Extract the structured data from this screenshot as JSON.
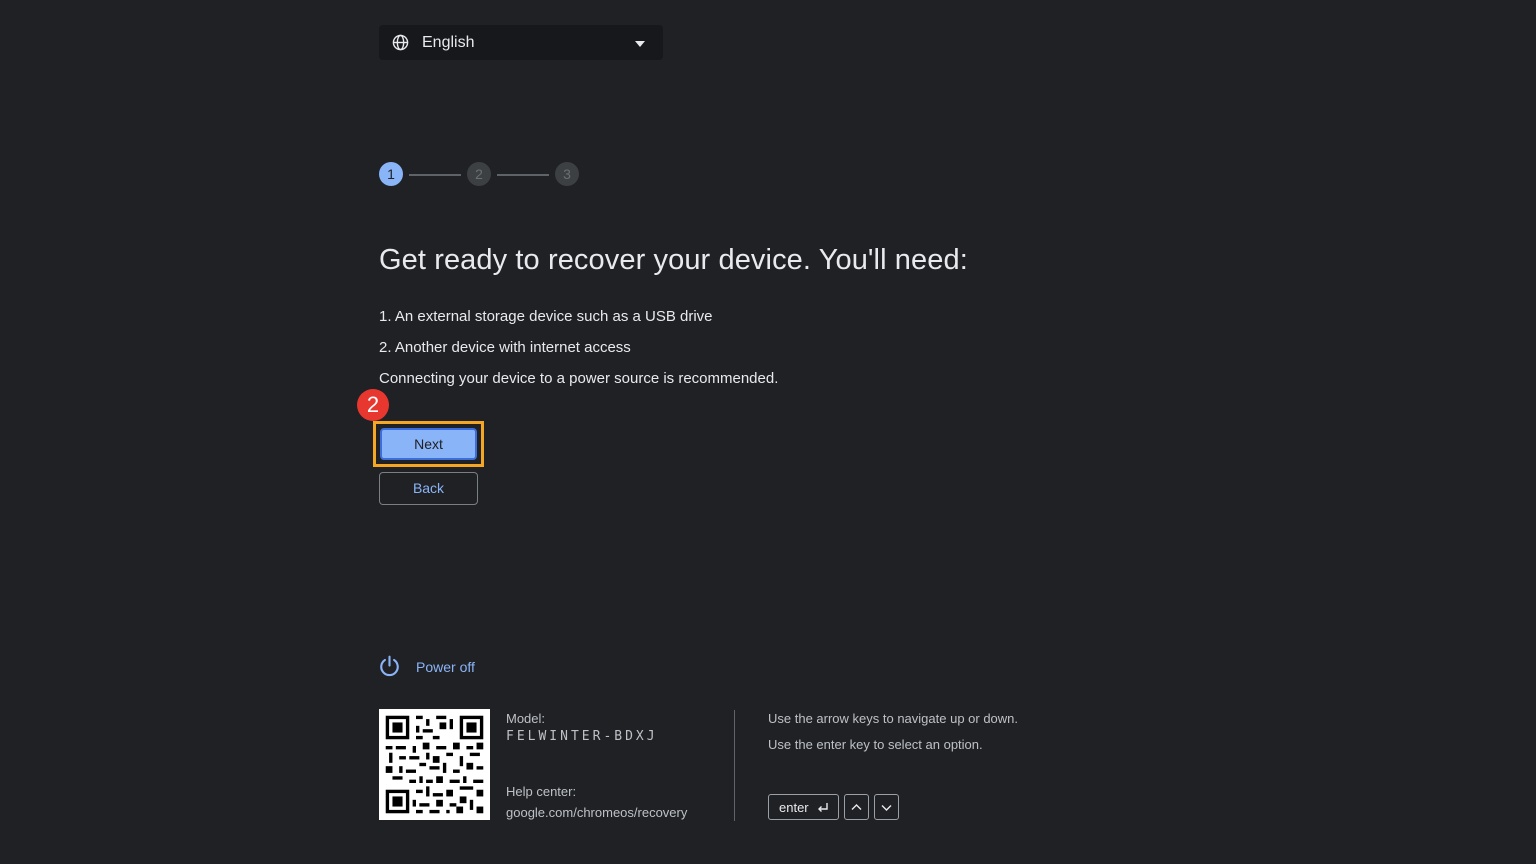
{
  "language_selector": {
    "value": "English",
    "icon": "globe-icon",
    "dropdown_icon": "caret-down-icon"
  },
  "stepper": {
    "steps": [
      "1",
      "2",
      "3"
    ],
    "active_step": 1,
    "active_color": "#8ab4f8"
  },
  "main": {
    "title": "Get ready to recover your device. You'll need:",
    "requirements": [
      "1. An external storage device such as a USB drive",
      "2. Another device with internet access"
    ],
    "note": "Connecting your device to a power source is recommended."
  },
  "annotation": {
    "badge_number": "2",
    "badge_color": "#e8372f",
    "highlight_color": "#f5a623"
  },
  "buttons": {
    "next_label": "Next",
    "back_label": "Back"
  },
  "power": {
    "label": "Power off",
    "icon": "power-icon"
  },
  "footer": {
    "model_label": "Model:",
    "model_value": "FELWINTER-BDXJ",
    "help_label": "Help center:",
    "help_link": "google.com/chromeos/recovery",
    "instructions": [
      "Use the arrow keys to navigate up or down.",
      "Use the enter key to select an option."
    ],
    "keys": {
      "enter_label": "enter",
      "enter_icon": "return-arrow-icon",
      "up_icon": "chevron-up-icon",
      "down_icon": "chevron-down-icon"
    }
  }
}
